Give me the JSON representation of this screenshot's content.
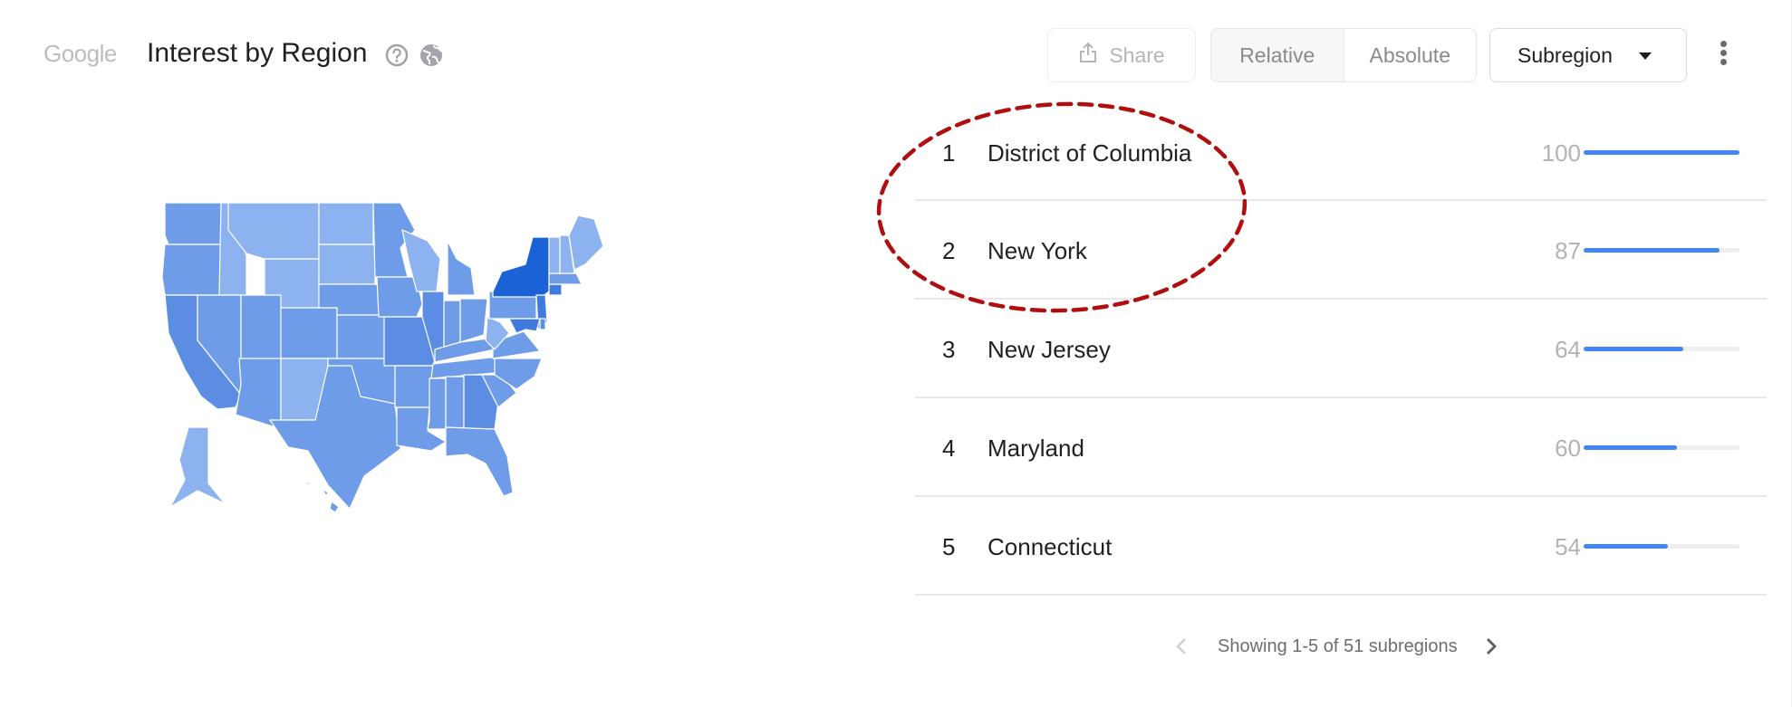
{
  "header": {
    "brand": "Google",
    "title": "Interest by Region",
    "icons": [
      "help-icon",
      "globe-icon"
    ]
  },
  "toolbar": {
    "share_label": "Share",
    "share_icon": "share-icon",
    "segments": [
      {
        "label": "Relative",
        "active": true
      },
      {
        "label": "Absolute",
        "active": false
      }
    ],
    "resolution_select": "Subregion",
    "more_icon": "more-vert-icon"
  },
  "colors": {
    "bar_fill": "#4285f4",
    "bar_track": "#eeeeee",
    "map_highest": "#1a62d5",
    "map_high": "#5b8de3",
    "map_mid": "#6e9ce8",
    "map_low": "#8cb2f0",
    "annotation": "#b00f0f"
  },
  "chart_data": {
    "type": "bar",
    "title": "Interest by Region",
    "categories": [
      "District of Columbia",
      "New York",
      "New Jersey",
      "Maryland",
      "Connecticut"
    ],
    "ranks": [
      1,
      2,
      3,
      4,
      5
    ],
    "values": [
      100,
      87,
      64,
      60,
      54
    ],
    "xlabel": "",
    "ylabel": "",
    "ylim": [
      0,
      100
    ],
    "orientation": "horizontal",
    "grid": false,
    "legend": "none",
    "annotations": [
      "dashed red ellipse around rows 1-2"
    ]
  },
  "map": {
    "type": "choropleth",
    "region": "United States",
    "highlighted": "New York"
  },
  "pager": {
    "text": "Showing 1-5 of 51 subregions",
    "prev_icon": "chevron-left-icon",
    "next_icon": "chevron-right-icon"
  }
}
